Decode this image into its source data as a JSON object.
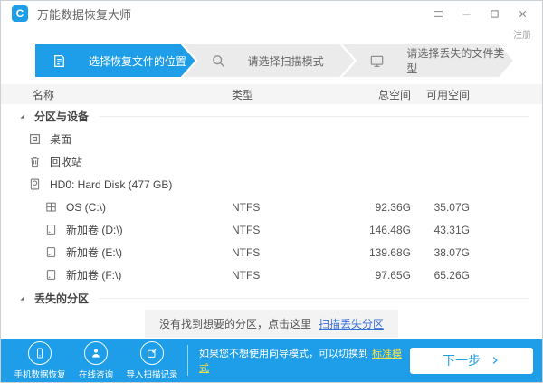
{
  "titlebar": {
    "title": "万能数据恢复大师",
    "logo_letter": "C"
  },
  "register": {
    "label": "注册"
  },
  "steps": [
    {
      "icon": "document-icon",
      "label": "选择恢复文件的位置",
      "active": true
    },
    {
      "icon": "search-icon",
      "label": "请选择扫描模式",
      "active": false
    },
    {
      "icon": "monitor-icon",
      "label": "请选择丢失的文件类型",
      "active": false
    }
  ],
  "table": {
    "columns": {
      "name": "名称",
      "type": "类型",
      "total": "总空间",
      "avail": "可用空间"
    }
  },
  "tree": {
    "sections": [
      {
        "label": "分区与设备",
        "items": [
          {
            "icon": "desktop-icon",
            "name": "桌面",
            "type": "",
            "total": "",
            "avail": "",
            "level": 1
          },
          {
            "icon": "trash-icon",
            "name": "回收站",
            "type": "",
            "total": "",
            "avail": "",
            "level": 1
          },
          {
            "icon": "harddisk-icon",
            "name": "HD0: Hard Disk (477 GB)",
            "type": "",
            "total": "",
            "avail": "",
            "level": 1
          },
          {
            "icon": "windows-drive-icon",
            "name": "OS (C:\\)",
            "type": "NTFS",
            "total": "92.36G",
            "avail": "35.07G",
            "level": 2
          },
          {
            "icon": "drive-icon",
            "name": "新加卷 (D:\\)",
            "type": "NTFS",
            "total": "146.48G",
            "avail": "43.31G",
            "level": 2
          },
          {
            "icon": "drive-icon",
            "name": "新加卷 (E:\\)",
            "type": "NTFS",
            "total": "139.68G",
            "avail": "38.07G",
            "level": 2
          },
          {
            "icon": "drive-icon",
            "name": "新加卷 (F:\\)",
            "type": "NTFS",
            "total": "97.65G",
            "avail": "65.26G",
            "level": 2
          }
        ]
      },
      {
        "label": "丢失的分区",
        "items": [],
        "empty_message": {
          "text": "没有找到想要的分区，点击这里",
          "link_label": "扫描丢失分区"
        }
      }
    ]
  },
  "footer": {
    "actions": [
      {
        "icon": "phone-icon",
        "label": "手机数据恢复"
      },
      {
        "icon": "person-icon",
        "label": "在线咨询"
      },
      {
        "icon": "import-icon",
        "label": "导入扫描记录"
      }
    ],
    "hint_text": "如果您不想使用向导模式，可以切换到",
    "hint_link": "标准模式",
    "next_label": "下一步"
  },
  "colors": {
    "accent": "#1E9DE8",
    "footer_link_yellow": "#F7E14B",
    "scan_link_blue": "#3A6FD8"
  }
}
